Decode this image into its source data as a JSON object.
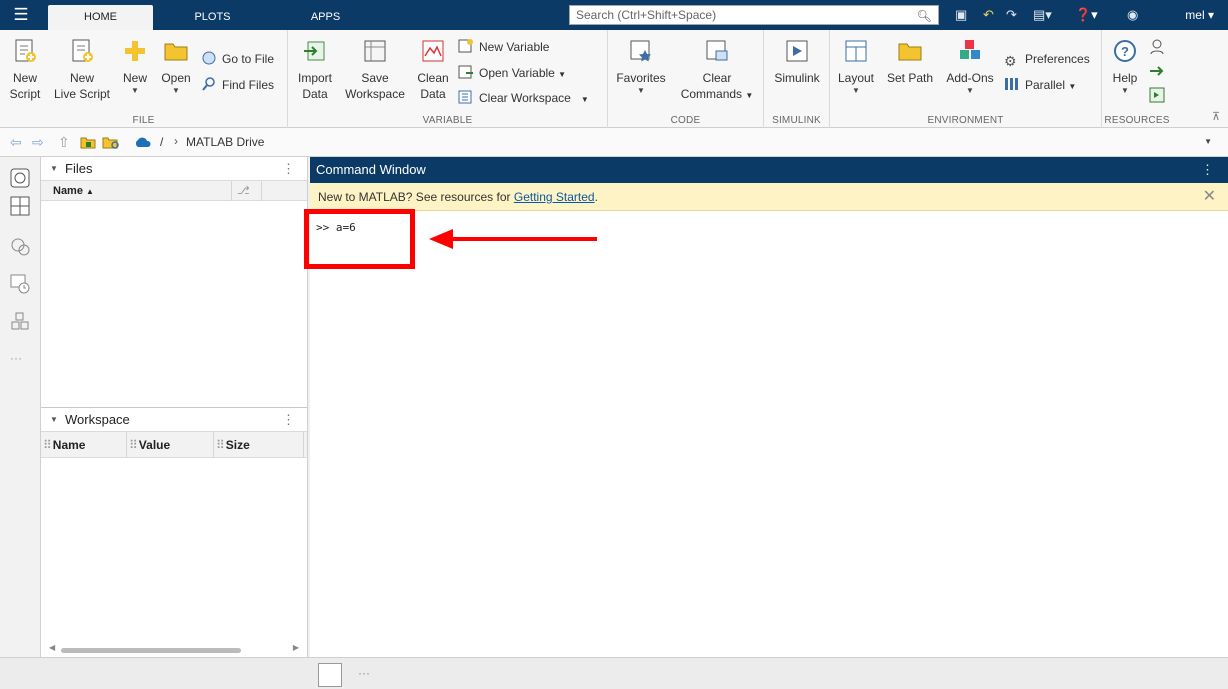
{
  "topbar": {
    "tabs": [
      "HOME",
      "PLOTS",
      "APPS"
    ],
    "search_placeholder": "Search (Ctrl+Shift+Space)",
    "user": "mel"
  },
  "ribbon": {
    "file": {
      "label": "FILE",
      "new_script": [
        "New",
        "Script"
      ],
      "new_live_script": [
        "New",
        "Live Script"
      ],
      "new": "New",
      "open": "Open",
      "go_to_file": "Go to File",
      "find_files": "Find Files"
    },
    "variable": {
      "label": "VARIABLE",
      "import_data": [
        "Import",
        "Data"
      ],
      "save_workspace": [
        "Save",
        "Workspace"
      ],
      "clean_data": [
        "Clean",
        "Data"
      ],
      "new_variable": "New Variable",
      "open_variable": "Open Variable",
      "clear_workspace": "Clear Workspace"
    },
    "code": {
      "label": "CODE",
      "favorites": "Favorites",
      "clear_commands": [
        "Clear",
        "Commands"
      ]
    },
    "simulink": {
      "label": "SIMULINK",
      "simulink": "Simulink"
    },
    "environment": {
      "label": "ENVIRONMENT",
      "layout": "Layout",
      "set_path": "Set Path",
      "add_ons": "Add-Ons",
      "preferences": "Preferences",
      "parallel": "Parallel"
    },
    "resources": {
      "label": "RESOURCES",
      "help": "Help"
    }
  },
  "address": {
    "separator": "/",
    "path": "MATLAB Drive"
  },
  "files_panel": {
    "title": "Files",
    "col_name": "Name"
  },
  "workspace_panel": {
    "title": "Workspace",
    "columns": [
      "Name",
      "Value",
      "Size"
    ]
  },
  "command_window": {
    "title": "Command Window",
    "banner_text": "New to MATLAB? See resources for ",
    "banner_link": "Getting Started",
    "banner_end": ".",
    "prompt": ">>",
    "command": "a=6",
    "annotation_color": "#ff0000"
  },
  "colors": {
    "topbar": "#0b3a66",
    "banner": "#fdf3c4",
    "link": "#0b57a6"
  }
}
